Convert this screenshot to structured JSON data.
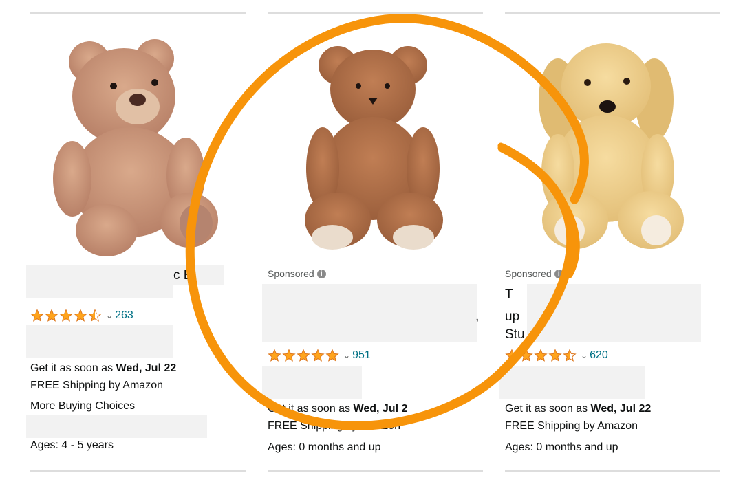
{
  "cards": [
    {
      "partial_title": "c E",
      "partial_subtitle": "...",
      "rating_count": "263",
      "rating": 4.5,
      "delivery_prefix": "Get it as soon as",
      "delivery_date": "Wed, Jul 22",
      "shipping": "FREE Shipping by Amazon",
      "more_choices": "More Buying Choices",
      "ages": "Ages: 4 - 5 years"
    },
    {
      "sponsored": "Sponsored",
      "partial_title": ",",
      "rating_count": "951",
      "rating": 5,
      "delivery_prefix": "Get it as soon as",
      "delivery_date": "Wed, Jul 2",
      "shipping": "FREE Shipping by Amazon",
      "ages": "Ages: 0 months and up"
    },
    {
      "sponsored": "Sponsored",
      "partial_lines": [
        "T",
        "up",
        "Stu"
      ],
      "rating_count": "620",
      "rating": 4.5,
      "delivery_prefix": "Get it as soon as",
      "delivery_date": "Wed, Jul 22",
      "shipping": "FREE Shipping by Amazon",
      "ages": "Ages: 0 months and up"
    }
  ],
  "icons": {
    "star": "star-icon",
    "half_star": "half-star-icon",
    "chevron": "chevron-down-icon",
    "info": "info-icon"
  },
  "colors": {
    "star_fill": "#ffa41c",
    "star_stroke": "#de7921",
    "link": "#007185",
    "annotation": "#f7940a"
  }
}
